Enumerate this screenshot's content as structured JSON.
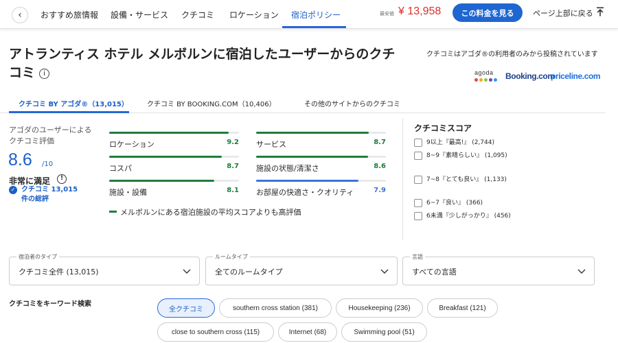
{
  "nav": {
    "tabs": [
      "おすすめ旅情報",
      "設備・サービス",
      "クチコミ",
      "ロケーション",
      "宿泊ポリシー"
    ],
    "active_tab": "宿泊ポリシー",
    "lowest_price_label": "最安値",
    "price": "¥ 13,958",
    "cta": "この料金を見る",
    "back_to_top": "ページ上部に戻る"
  },
  "header": {
    "title": "アトランティス ホテル メルボルンに宿泊したユーザーからのクチコミ",
    "note": "クチコミはアゴダ®の利用者のみから投稿されています",
    "logos": [
      "agoda",
      "Booking.com",
      "priceline.com"
    ]
  },
  "source_tabs": [
    "クチコミ BY アゴダ®（13,015）",
    "クチコミ BY BOOKING.COM（10,406）",
    "その他のサイトからのクチコミ"
  ],
  "summary": {
    "label": "アゴダのユーザーによるクチコミ評価",
    "score": "8.6",
    "max": "/10",
    "word": "非常に満足",
    "count": "クチコミ 13,015 件の総評"
  },
  "ratings": [
    {
      "label": "ロケーション",
      "value": 9.2,
      "display": "9.2",
      "above_average": true
    },
    {
      "label": "サービス",
      "value": 8.7,
      "display": "8.7",
      "above_average": true
    },
    {
      "label": "コスパ",
      "value": 8.7,
      "display": "8.7",
      "above_average": true
    },
    {
      "label": "施設の状態/清潔さ",
      "value": 8.6,
      "display": "8.6",
      "above_average": true
    },
    {
      "label": "施設・設備",
      "value": 8.1,
      "display": "8.1",
      "above_average": true
    },
    {
      "label": "お部屋の快適さ・クオリティ",
      "value": 7.9,
      "display": "7.9",
      "above_average": false
    }
  ],
  "legend": "メルボルンにある宿泊施設の平均スコアよりも高評価",
  "colors": {
    "accent": "#1f66d1",
    "above_average": "#1e7d3b",
    "regular": "#3b74d6",
    "price": "#e12d2d"
  },
  "score_filter": {
    "title": "クチコミスコア",
    "items": [
      {
        "text": "9以上『最高!』 (2,744)",
        "checked": false
      },
      {
        "text": "8~9『素晴らしい』 (1,095)",
        "checked": false
      },
      {
        "text": "7~8『とても良い』 (1,133)",
        "checked": false
      },
      {
        "text": "6~7『良い』 (366)",
        "checked": false
      },
      {
        "text": "6未満『少しがっかり』 (456)",
        "checked": false
      }
    ]
  },
  "filters": [
    {
      "label": "宿泊者のタイプ",
      "value": "クチコミ全件 (13,015)"
    },
    {
      "label": "ルームタイプ",
      "value": "全てのルームタイプ"
    },
    {
      "label": "言語",
      "value": "すべての言語"
    }
  ],
  "keyword": {
    "title": "クチコミをキーワード検索",
    "chips": [
      "全クチコミ",
      "southern cross station (381)",
      "Housekeeping (236)",
      "Breakfast (121)",
      "close to southern cross (115)",
      "Internet (68)",
      "Swimming pool (51)"
    ],
    "active": "全クチコミ"
  }
}
